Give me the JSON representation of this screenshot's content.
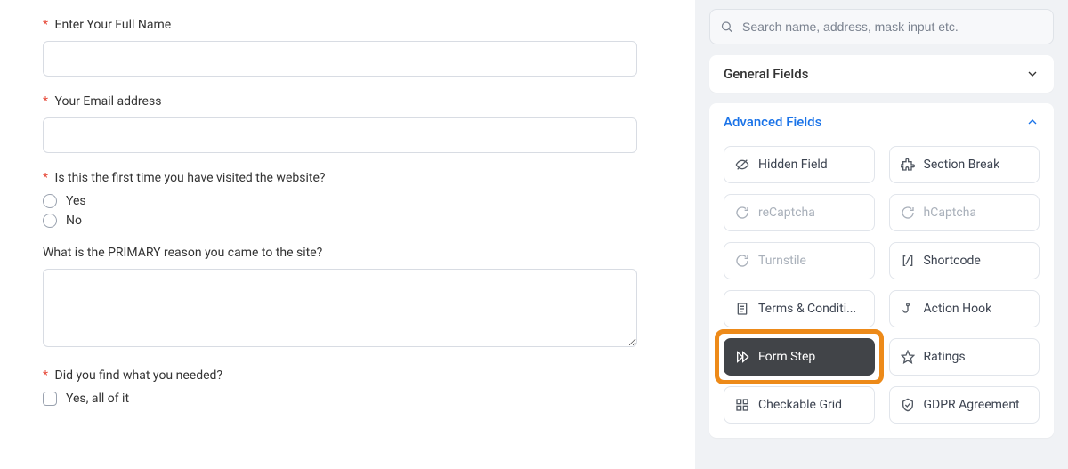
{
  "form": {
    "name_label": "Enter Your Full Name",
    "email_label": "Your Email address",
    "first_visit_label": "Is this the first time you have visited the website?",
    "first_visit_yes": "Yes",
    "first_visit_no": "No",
    "primary_reason_label": "What is the PRIMARY reason you came to the site?",
    "found_label": "Did you find what you needed?",
    "found_yes_all": "Yes, all of it"
  },
  "sidebar": {
    "search_placeholder": "Search name, address, mask input etc.",
    "general_title": "General Fields",
    "advanced_title": "Advanced Fields",
    "items": {
      "hidden": "Hidden Field",
      "section_break": "Section Break",
      "recaptcha": "reCaptcha",
      "hcaptcha": "hCaptcha",
      "turnstile": "Turnstile",
      "shortcode": "Shortcode",
      "terms": "Terms & Conditi...",
      "action_hook": "Action Hook",
      "form_step": "Form Step",
      "ratings": "Ratings",
      "checkable_grid": "Checkable Grid",
      "gdpr": "GDPR Agreement"
    }
  }
}
